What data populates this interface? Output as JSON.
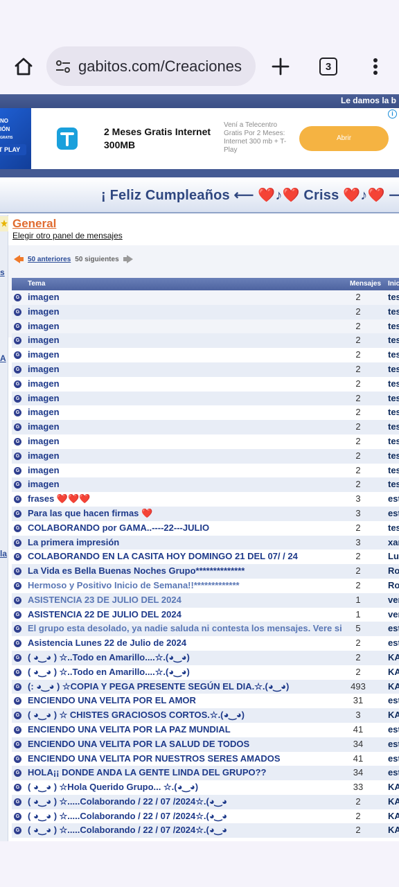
{
  "browser": {
    "url": "gabitos.com/Creaciones",
    "tab_count": "3"
  },
  "page": {
    "top_strip_text": "Le damos la b",
    "ad": {
      "thumb_lines": [
        "NO",
        "IÓN",
        "GRATIS",
        "T PLAY"
      ],
      "title": "2 Meses Gratis Internet 300MB",
      "description": "Vení a Telecentro Gratis Por 2 Meses: Internet 300 mb + T-Play",
      "button": "Abrir",
      "info": "i"
    },
    "banner": "¡ Feliz Cumpleaños ⟵ ❤️♪❤️ Criss ❤️♪❤️ ⟶",
    "left_fragments": [
      "s",
      "A",
      "la"
    ],
    "forum": {
      "title": "General",
      "subtitle": "Elegir otro panel de mensajes"
    },
    "pager": {
      "prev": "50 anteriores",
      "next": "50 siguientes"
    },
    "table": {
      "headers": [
        "Tema",
        "Mensajes",
        "Inicia"
      ],
      "rows": [
        {
          "topic": "imagen",
          "count": "2",
          "author": "tes"
        },
        {
          "topic": "imagen",
          "count": "2",
          "author": "tes"
        },
        {
          "topic": "imagen",
          "count": "2",
          "author": "tes"
        },
        {
          "topic": "imagen",
          "count": "2",
          "author": "tes"
        },
        {
          "topic": "imagen",
          "count": "2",
          "author": "tes"
        },
        {
          "topic": "imagen",
          "count": "2",
          "author": "tes"
        },
        {
          "topic": "imagen",
          "count": "2",
          "author": "tes"
        },
        {
          "topic": "imagen",
          "count": "2",
          "author": "tes"
        },
        {
          "topic": "imagen",
          "count": "2",
          "author": "tes"
        },
        {
          "topic": "imagen",
          "count": "2",
          "author": "tes"
        },
        {
          "topic": "imagen",
          "count": "2",
          "author": "tes"
        },
        {
          "topic": "imagen",
          "count": "2",
          "author": "tes"
        },
        {
          "topic": "imagen",
          "count": "2",
          "author": "tes"
        },
        {
          "topic": "imagen",
          "count": "2",
          "author": "tes"
        },
        {
          "topic": "frases ❤️❤️❤️",
          "count": "3",
          "author": "est"
        },
        {
          "topic": "Para las que hacen firmas ❤️",
          "count": "3",
          "author": "est"
        },
        {
          "topic": "COLABORANDO por GAMA..----22---JULIO",
          "count": "2",
          "author": "tes"
        },
        {
          "topic": "La primera impresión",
          "count": "3",
          "author": "xar"
        },
        {
          "topic": "COLABORANDO EN LA CASITA HOY DOMINGO 21 DEL 07/ / 24",
          "count": "2",
          "author": "Lui"
        },
        {
          "topic": "La Vida es Bella Buenas Noches Grupo**************",
          "count": "2",
          "author": "Ro"
        },
        {
          "topic": "Hermoso y Positivo Inicio de Semana!!*************",
          "count": "2",
          "author": "Ro",
          "faint": true
        },
        {
          "topic": "ASISTENCIA 23 DE JULIO DEL 2024",
          "count": "1",
          "author": "ver",
          "faint": true
        },
        {
          "topic": "ASISTENCIA 22 DE JULIO DEL 2024",
          "count": "1",
          "author": "ver"
        },
        {
          "topic": "El grupo esta desolado, ya nadie saluda ni contesta los mensajes. Vere si sigo",
          "count": "5",
          "author": "est",
          "faint": true
        },
        {
          "topic": "Asistencia Lunes 22 de Julio de 2024",
          "count": "2",
          "author": "est"
        },
        {
          "topic": "( ◕‿◕ ) ☆..Todo en Amarillo....☆.(◕‿◕)",
          "count": "2",
          "author": "KA"
        },
        {
          "topic": "( ◕‿◕ ) ☆..Todo en Amarillo....☆.(◕‿◕)",
          "count": "2",
          "author": "KA"
        },
        {
          "topic": "(: ◕‿◕ ) ☆COPIA Y PEGA PRESENTE SEGÚN EL DIA.☆.(◕‿◕)",
          "count": "493",
          "author": "KA"
        },
        {
          "topic": "ENCIENDO UNA VELITA POR EL AMOR",
          "count": "31",
          "author": "est"
        },
        {
          "topic": "( ◕‿◕ ) ☆ CHISTES GRACIOSOS CORTOS.☆.(◕‿◕)",
          "count": "3",
          "author": "KA"
        },
        {
          "topic": "ENCIENDO UNA VELITA POR LA PAZ MUNDIAL",
          "count": "41",
          "author": "est"
        },
        {
          "topic": "ENCIENDO UNA VELITA POR LA SALUD DE TODOS",
          "count": "34",
          "author": "est"
        },
        {
          "topic": "ENCIENDO UNA VELITA POR NUESTROS SERES AMADOS",
          "count": "41",
          "author": "est"
        },
        {
          "topic": "HOLA¡¡ DONDE ANDA LA GENTE LINDA DEL GRUPO??",
          "count": "34",
          "author": "est"
        },
        {
          "topic": "( ◕‿◕ ) ☆Hola Querido Grupo... ☆.(◕‿◕)",
          "count": "33",
          "author": "KA"
        },
        {
          "topic": "( ◕‿◕ ) ☆.....Colaborando / 22 / 07 /2024☆.(◕‿◕",
          "count": "2",
          "author": "KA"
        },
        {
          "topic": "( ◕‿◕ ) ☆.....Colaborando / 22 / 07 /2024☆.(◕‿◕",
          "count": "2",
          "author": "KA"
        },
        {
          "topic": "( ◕‿◕ ) ☆.....Colaborando / 22 / 07 /2024☆.(◕‿◕",
          "count": "2",
          "author": "KA"
        }
      ]
    }
  }
}
